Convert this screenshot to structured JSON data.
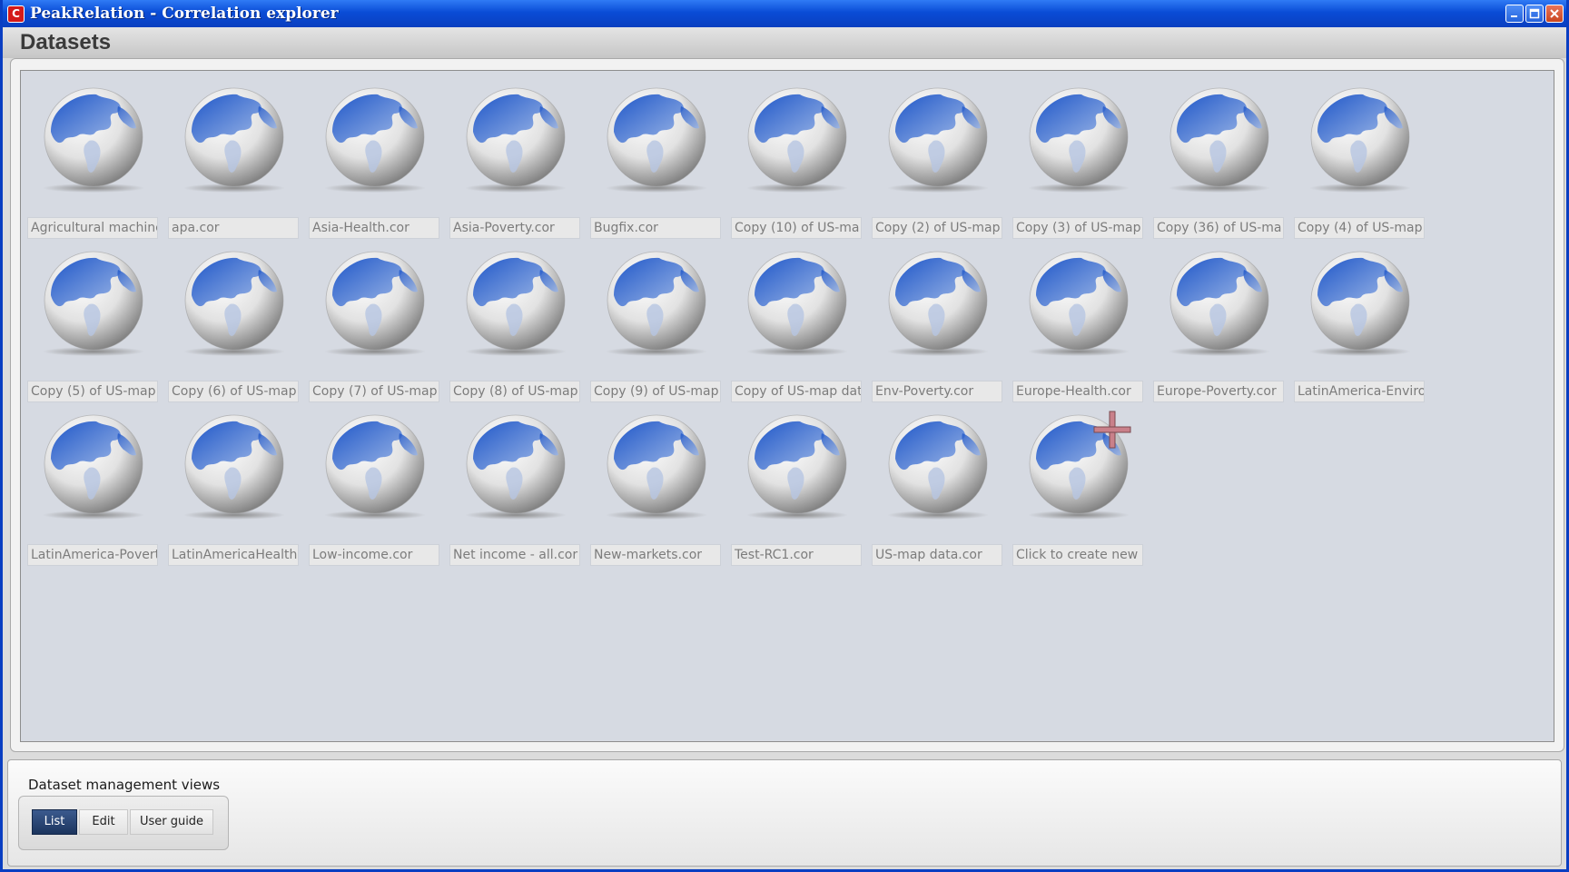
{
  "window": {
    "title": "PeakRelation - Correlation explorer",
    "app_icon_glyph": "C"
  },
  "datasets": {
    "title": "Datasets",
    "items": [
      {
        "label": "Agricultural machine"
      },
      {
        "label": "apa.cor"
      },
      {
        "label": "Asia-Health.cor"
      },
      {
        "label": "Asia-Poverty.cor"
      },
      {
        "label": "Bugfix.cor"
      },
      {
        "label": "Copy (10) of US-ma"
      },
      {
        "label": "Copy (2) of US-map"
      },
      {
        "label": "Copy (3) of US-map"
      },
      {
        "label": "Copy (36) of US-ma"
      },
      {
        "label": "Copy (4) of US-map"
      },
      {
        "label": "Copy (5) of US-map"
      },
      {
        "label": "Copy (6) of US-map"
      },
      {
        "label": "Copy (7) of US-map"
      },
      {
        "label": "Copy (8) of US-map"
      },
      {
        "label": "Copy (9) of US-map"
      },
      {
        "label": "Copy of US-map dat"
      },
      {
        "label": "Env-Poverty.cor"
      },
      {
        "label": "Europe-Health.cor"
      },
      {
        "label": "Europe-Poverty.cor"
      },
      {
        "label": "LatinAmerica-Enviro"
      },
      {
        "label": "LatinAmerica-Povert"
      },
      {
        "label": "LatinAmericaHealth."
      },
      {
        "label": "Low-income.cor"
      },
      {
        "label": "Net income - all.cor"
      },
      {
        "label": "New-markets.cor"
      },
      {
        "label": "Test-RC1.cor"
      },
      {
        "label": "US-map data.cor"
      }
    ],
    "create_new_label": "Click to create new",
    "icon": "globe-icon",
    "create_icon": "plus-icon"
  },
  "views": {
    "title": "Dataset management views",
    "buttons": [
      {
        "label": "List",
        "active": true
      },
      {
        "label": "Edit",
        "active": false
      },
      {
        "label": "User guide",
        "active": false
      }
    ]
  },
  "colors": {
    "titlebar": "#0a4cd6",
    "panel": "#d6dae2",
    "active_button": "#1c355e",
    "plus_icon": "#c9808a"
  }
}
